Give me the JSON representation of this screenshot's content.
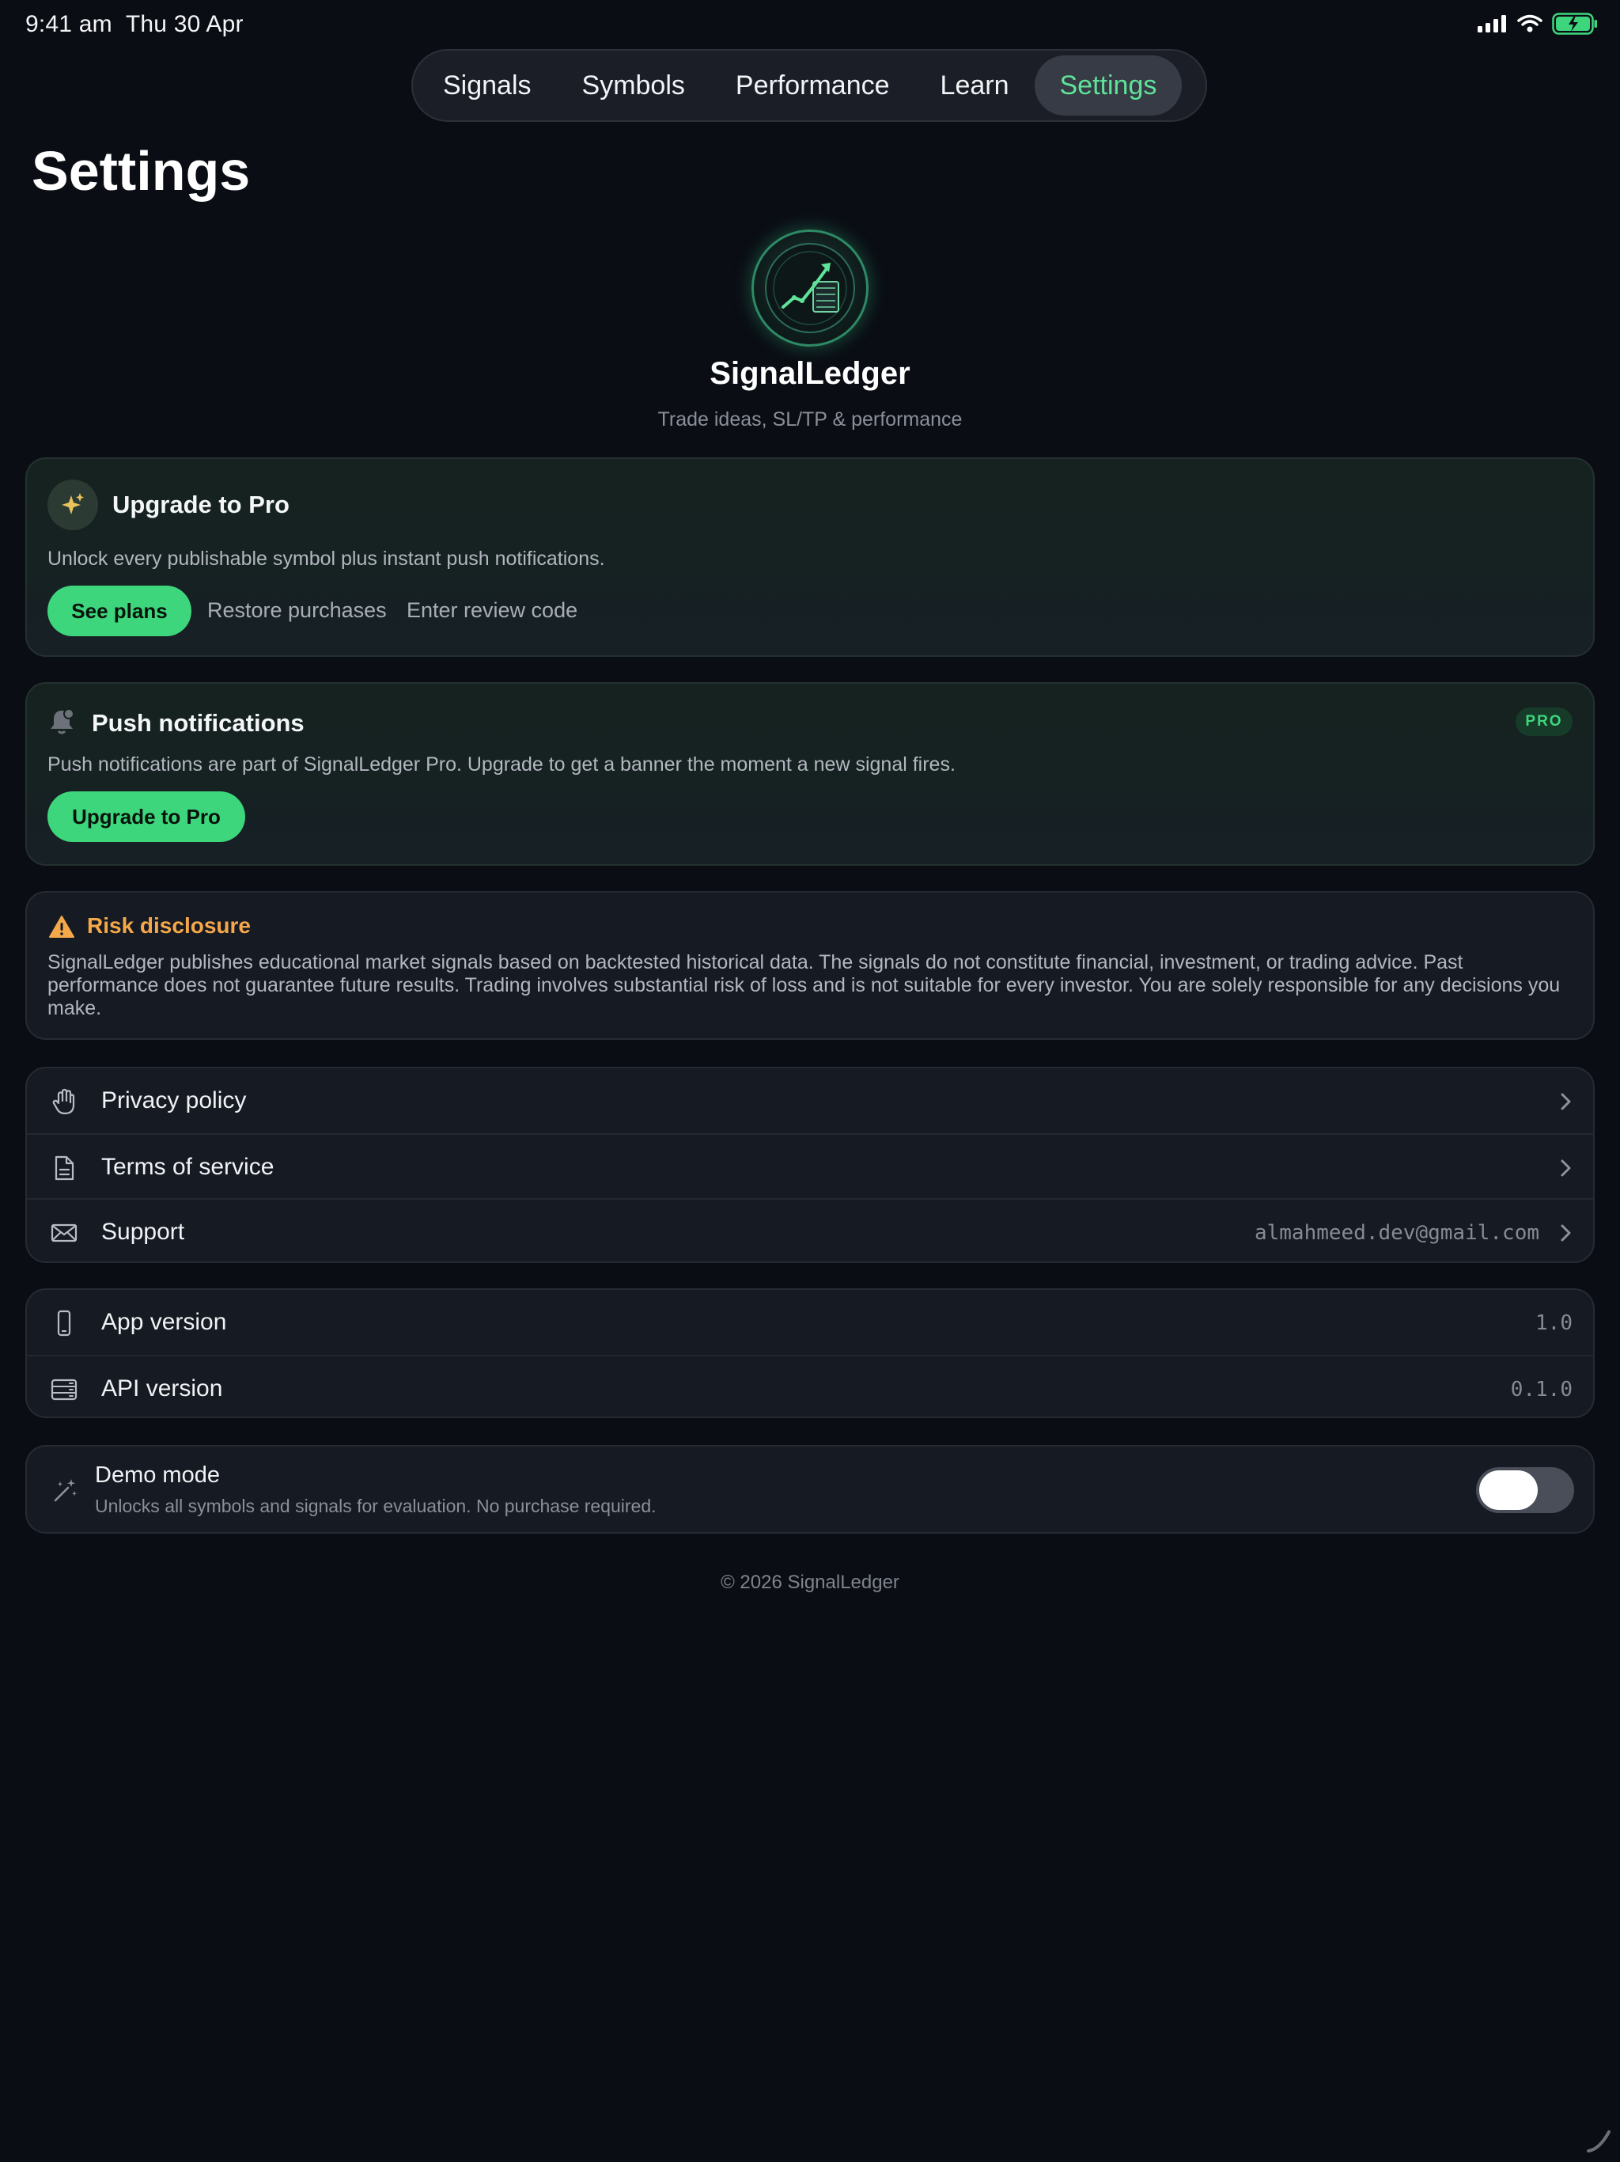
{
  "status_bar": {
    "time": "9:41 am",
    "date": "Thu 30 Apr"
  },
  "tabs": [
    {
      "label": "Signals",
      "active": false
    },
    {
      "label": "Symbols",
      "active": false
    },
    {
      "label": "Performance",
      "active": false
    },
    {
      "label": "Learn",
      "active": false
    },
    {
      "label": "Settings",
      "active": true
    }
  ],
  "page_title": "Settings",
  "profile": {
    "app_name": "SignalLedger",
    "tagline": "Trade ideas, SL/TP & performance",
    "logo_icon": "chart-arrow-logo-icon"
  },
  "upgrade_card": {
    "title": "Upgrade to Pro",
    "icon": "sparkles-icon",
    "body": "Unlock every publishable symbol plus instant push notifications.",
    "primary_button": "See plans",
    "restore_link": "Restore purchases",
    "review_code_link": "Enter review code"
  },
  "push_card": {
    "title": "Push notifications",
    "icon": "bell-icon",
    "badge": "PRO",
    "body": "Push notifications are part of SignalLedger Pro. Upgrade to get a banner the moment a new signal fires.",
    "button": "Upgrade to Pro"
  },
  "risk_card": {
    "title": "Risk disclosure",
    "icon": "warning-icon",
    "body": "SignalLedger publishes educational market signals based on backtested historical data. The signals do not constitute financial, investment, or trading advice. Past performance does not guarantee future results. Trading involves substantial risk of loss and is not suitable for every investor. You are solely responsible for any decisions you make."
  },
  "links": [
    {
      "label": "Privacy policy",
      "icon": "hand-raised-icon",
      "value": ""
    },
    {
      "label": "Terms of service",
      "icon": "document-icon",
      "value": ""
    },
    {
      "label": "Support",
      "icon": "envelope-icon",
      "value": "almahmeed.dev@gmail.com"
    }
  ],
  "versions": [
    {
      "label": "App version",
      "icon": "phone-icon",
      "value": "1.0"
    },
    {
      "label": "API version",
      "icon": "server-icon",
      "value": "0.1.0"
    }
  ],
  "demo_mode": {
    "title": "Demo mode",
    "subtitle": "Unlocks all symbols and signals for evaluation. No purchase required.",
    "icon": "magic-wand-icon",
    "enabled": false
  },
  "footer": "© 2026 SignalLedger",
  "colors": {
    "background": "#0a0d14",
    "accent": "#3ed67c",
    "warning": "#f5a84a",
    "card": "#161a22"
  }
}
